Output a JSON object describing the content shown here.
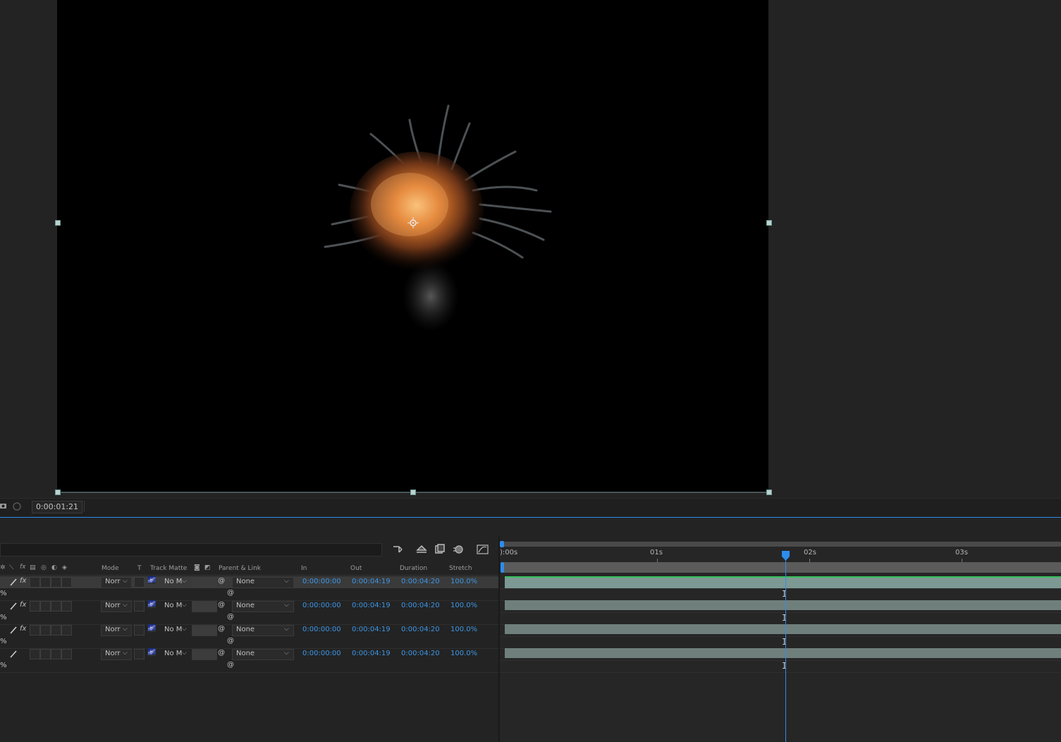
{
  "viewer": {
    "timecode": "0:00:01:21",
    "content": "explosion-footage"
  },
  "timeline": {
    "toolbar_icons": [
      "composition-flowchart-icon",
      "draft-3d-icon",
      "frame-blending-icon",
      "motion-blur-icon",
      "graph-editor-icon"
    ],
    "header": {
      "mode": "Mode",
      "t": "T",
      "track_matte": "Track Matte",
      "parent_link": "Parent & Link",
      "in": "In",
      "out": "Out",
      "duration": "Duration",
      "stretch": "Stretch"
    },
    "layers": [
      {
        "mode": "Norr",
        "matte": "No M",
        "parent": "None",
        "in": "0:00:00:00",
        "out": "0:00:04:19",
        "duration": "0:00:04:20",
        "stretch": "100.0%",
        "sub": "%",
        "fx": "fx",
        "selected": true
      },
      {
        "mode": "Norr",
        "matte": "No M",
        "parent": "None",
        "in": "0:00:00:00",
        "out": "0:00:04:19",
        "duration": "0:00:04:20",
        "stretch": "100.0%",
        "sub": "%",
        "fx": "fx",
        "selected": false
      },
      {
        "mode": "Norr",
        "matte": "No M",
        "parent": "None",
        "in": "0:00:00:00",
        "out": "0:00:04:19",
        "duration": "0:00:04:20",
        "stretch": "100.0%",
        "sub": "%",
        "fx": "fx",
        "selected": false
      },
      {
        "mode": "Norr",
        "matte": "No M",
        "parent": "None",
        "in": "0:00:00:00",
        "out": "0:00:04:19",
        "duration": "0:00:04:20",
        "stretch": "100.0%",
        "sub": "%",
        "fx": "",
        "selected": false
      }
    ],
    "ruler": {
      "labels": [
        "):00s",
        "01s",
        "02s",
        "03s"
      ]
    },
    "accent_blue": "#2d8ceb",
    "selected_bar_color": "#38c05d"
  }
}
